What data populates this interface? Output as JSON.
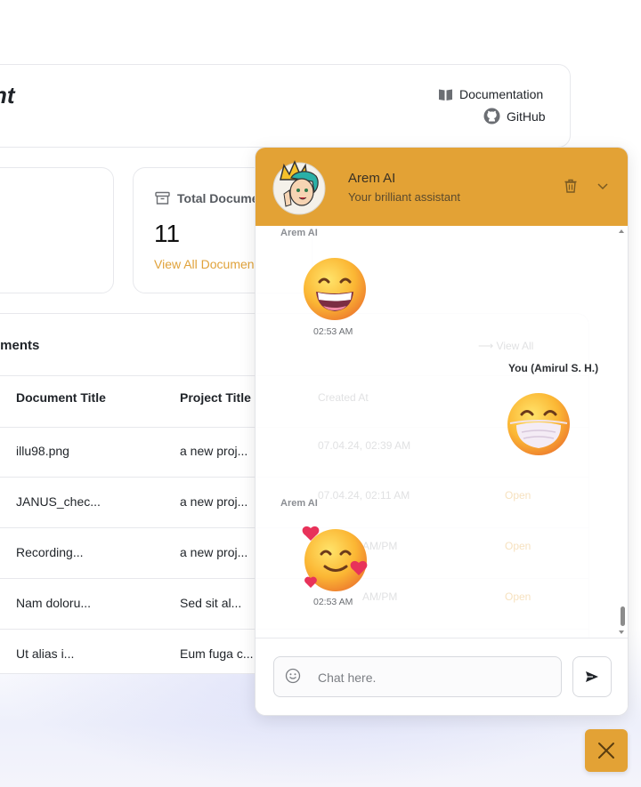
{
  "header": {
    "title_fragment": "nt",
    "documentation_label": "Documentation",
    "github_label": "GitHub"
  },
  "stats": {
    "total_documents": {
      "label": "Total Docume",
      "value": "11",
      "link": "View All Documen"
    }
  },
  "table": {
    "heading": "uments",
    "columns": [
      "Document Title",
      "Project Title"
    ],
    "rows": [
      [
        "illu98.png",
        "a new proj..."
      ],
      [
        "JANUS_chec...",
        "a new proj..."
      ],
      [
        "Recording...",
        "a new proj..."
      ],
      [
        "Nam doloru...",
        "Sed sit al..."
      ],
      [
        "Ut alias i...",
        "Eum fuga c..."
      ]
    ]
  },
  "chat": {
    "bot_name": "Arem AI",
    "bot_subtitle": "Your brilliant assistant",
    "messages": [
      {
        "sender": "Arem AI",
        "emoji": "grinning-face",
        "time": "02:53 AM"
      },
      {
        "sender": "You (Amirul S. H.)",
        "emoji": "face-with-medical-mask",
        "time": ""
      },
      {
        "sender": "Arem AI",
        "emoji": "smiling-face-with-hearts",
        "time": "02:53 AM"
      }
    ],
    "input_placeholder": "Chat here.",
    "colors": {
      "header": "#e3a235",
      "accent": "#e0a23a"
    }
  },
  "icons": [
    "book-icon",
    "github-icon",
    "archive-icon",
    "trash-icon",
    "chevron-down-icon",
    "smile-icon",
    "send-icon",
    "close-icon"
  ]
}
